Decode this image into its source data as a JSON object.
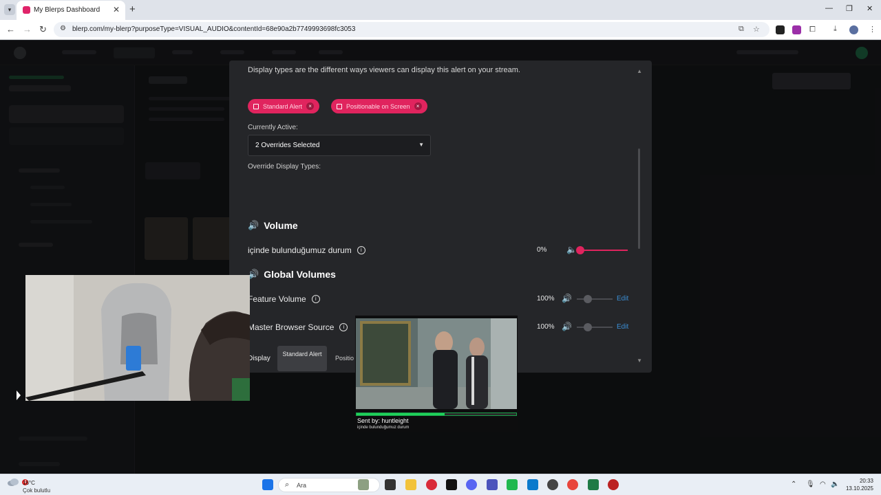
{
  "browser": {
    "tab_title": "My Blerps Dashboard",
    "tab_close": "✕",
    "new_tab": "+",
    "url": "blerp.com/my-blerp?purposeType=VISUAL_AUDIO&contentId=68e90a2b7749993698fc3053"
  },
  "modal": {
    "cut_text": "Display types are the different ways viewers can display this alert on your stream.",
    "currently_active_label": "Currently Active:",
    "chips": [
      "Standard Alert",
      "Positionable on Screen"
    ],
    "override_label": "Override Display Types:",
    "override_value": "2 Overrides Selected",
    "volume_title": "Volume",
    "sound_name": "içinde bulunduğumuz durum",
    "sound_volume": "0%",
    "global_title": "Global Volumes",
    "feature_label": "Feature Volume",
    "feature_volume": "100%",
    "master_label": "Master Browser Source",
    "master_volume": "100%",
    "edit_label": "Edit",
    "display_label": "Display",
    "display_tab_active": "Standard Alert",
    "display_tab_other": "Positio"
  },
  "alert": {
    "sender": "Sent by: huntleight",
    "message": "içinde bulunduğumuz durum",
    "progress": 0.55
  },
  "taskbar": {
    "temp": "16°C",
    "weather": "Çok bulutlu",
    "weather_badge": "4",
    "search_placeholder": "Ara",
    "time": "20:33",
    "date": "13.10.2025"
  },
  "colors": {
    "accent": "#e0245e",
    "link": "#3b8fd6",
    "progress": "#1fd15a"
  }
}
